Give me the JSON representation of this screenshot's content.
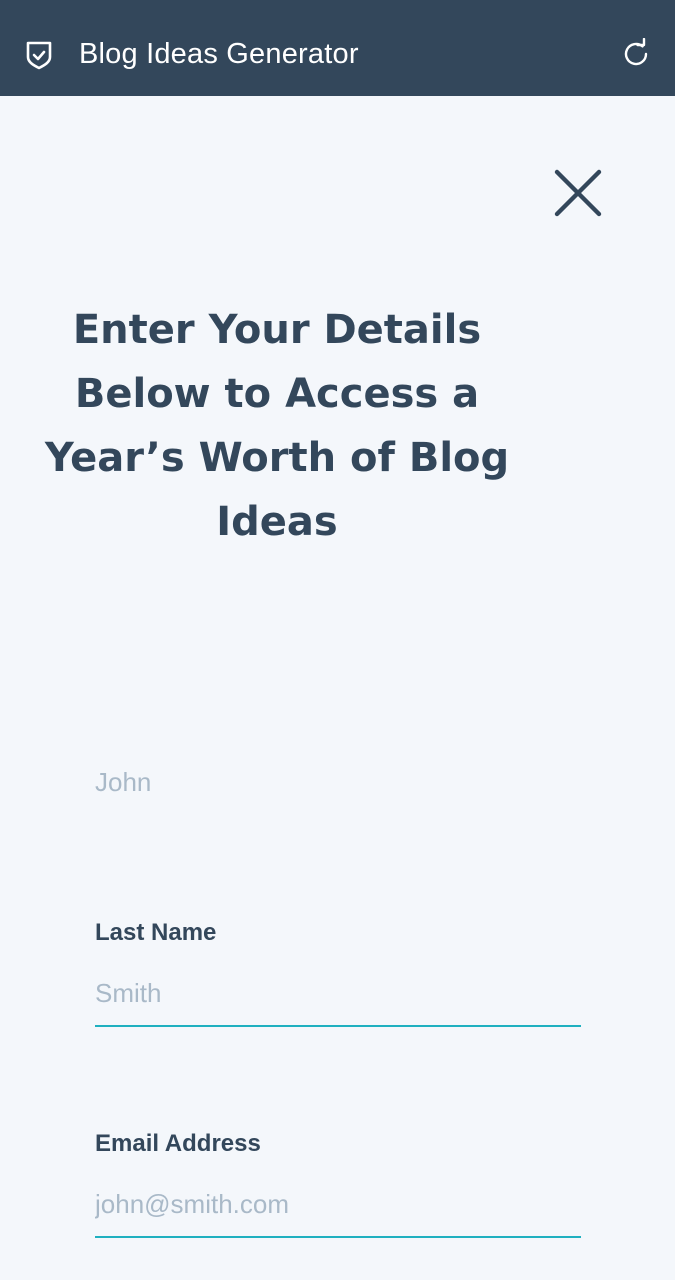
{
  "header": {
    "title": "Blog Ideas Generator",
    "left_icon": "shield-check-icon",
    "right_icon": "refresh-icon",
    "background": "#33475b"
  },
  "dialog": {
    "close_icon": "close-icon",
    "heading_lines": [
      "Enter Your Details",
      "Below to Access a",
      "Year’s Worth of Blog",
      "Ideas"
    ]
  },
  "form": {
    "first_name": {
      "placeholder": "John"
    },
    "last_name": {
      "label": "Last Name",
      "placeholder": "Smith"
    },
    "email": {
      "label": "Email Address",
      "placeholder": "john@smith.com"
    }
  },
  "colors": {
    "accent": "#1fb0c0",
    "text": "#33475b",
    "placeholder": "#a9b9c8",
    "page_background": "#f4f7fb"
  }
}
